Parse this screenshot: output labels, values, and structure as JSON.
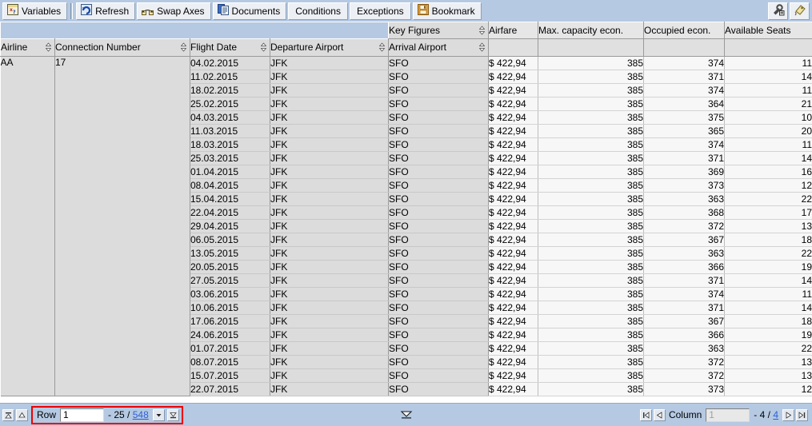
{
  "toolbar": {
    "buttons": [
      {
        "label": "Variables",
        "icon": "variables-icon"
      },
      {
        "label": "Refresh",
        "icon": "refresh-icon"
      },
      {
        "label": "Swap Axes",
        "icon": "swap-axes-icon"
      },
      {
        "label": "Documents",
        "icon": "documents-icon"
      },
      {
        "label": "Conditions",
        "icon": "none"
      },
      {
        "label": "Exceptions",
        "icon": "none"
      },
      {
        "label": "Bookmark",
        "icon": "bookmark-icon"
      }
    ],
    "right_buttons": [
      {
        "icon": "settings-wrench-icon"
      },
      {
        "icon": "info-tag-icon"
      }
    ]
  },
  "grid": {
    "key_figures_label": "Key Figures",
    "dimension_headers": [
      "Airline",
      "Connection Number",
      "Flight Date",
      "Departure Airport",
      "Arrival Airport"
    ],
    "key_figure_headers": [
      "Airfare",
      "Max. capacity econ.",
      "Occupied econ.",
      "Available Seats"
    ],
    "airline": "AA",
    "connection_number": "17",
    "rows": [
      {
        "flight_date": "04.02.2015",
        "departure": "JFK",
        "arrival": "SFO",
        "airfare": "$ 422,94",
        "max_capacity": "385",
        "occupied": "374",
        "available": "11"
      },
      {
        "flight_date": "11.02.2015",
        "departure": "JFK",
        "arrival": "SFO",
        "airfare": "$ 422,94",
        "max_capacity": "385",
        "occupied": "371",
        "available": "14"
      },
      {
        "flight_date": "18.02.2015",
        "departure": "JFK",
        "arrival": "SFO",
        "airfare": "$ 422,94",
        "max_capacity": "385",
        "occupied": "374",
        "available": "11"
      },
      {
        "flight_date": "25.02.2015",
        "departure": "JFK",
        "arrival": "SFO",
        "airfare": "$ 422,94",
        "max_capacity": "385",
        "occupied": "364",
        "available": "21"
      },
      {
        "flight_date": "04.03.2015",
        "departure": "JFK",
        "arrival": "SFO",
        "airfare": "$ 422,94",
        "max_capacity": "385",
        "occupied": "375",
        "available": "10"
      },
      {
        "flight_date": "11.03.2015",
        "departure": "JFK",
        "arrival": "SFO",
        "airfare": "$ 422,94",
        "max_capacity": "385",
        "occupied": "365",
        "available": "20"
      },
      {
        "flight_date": "18.03.2015",
        "departure": "JFK",
        "arrival": "SFO",
        "airfare": "$ 422,94",
        "max_capacity": "385",
        "occupied": "374",
        "available": "11"
      },
      {
        "flight_date": "25.03.2015",
        "departure": "JFK",
        "arrival": "SFO",
        "airfare": "$ 422,94",
        "max_capacity": "385",
        "occupied": "371",
        "available": "14"
      },
      {
        "flight_date": "01.04.2015",
        "departure": "JFK",
        "arrival": "SFO",
        "airfare": "$ 422,94",
        "max_capacity": "385",
        "occupied": "369",
        "available": "16"
      },
      {
        "flight_date": "08.04.2015",
        "departure": "JFK",
        "arrival": "SFO",
        "airfare": "$ 422,94",
        "max_capacity": "385",
        "occupied": "373",
        "available": "12"
      },
      {
        "flight_date": "15.04.2015",
        "departure": "JFK",
        "arrival": "SFO",
        "airfare": "$ 422,94",
        "max_capacity": "385",
        "occupied": "363",
        "available": "22"
      },
      {
        "flight_date": "22.04.2015",
        "departure": "JFK",
        "arrival": "SFO",
        "airfare": "$ 422,94",
        "max_capacity": "385",
        "occupied": "368",
        "available": "17"
      },
      {
        "flight_date": "29.04.2015",
        "departure": "JFK",
        "arrival": "SFO",
        "airfare": "$ 422,94",
        "max_capacity": "385",
        "occupied": "372",
        "available": "13"
      },
      {
        "flight_date": "06.05.2015",
        "departure": "JFK",
        "arrival": "SFO",
        "airfare": "$ 422,94",
        "max_capacity": "385",
        "occupied": "367",
        "available": "18"
      },
      {
        "flight_date": "13.05.2015",
        "departure": "JFK",
        "arrival": "SFO",
        "airfare": "$ 422,94",
        "max_capacity": "385",
        "occupied": "363",
        "available": "22"
      },
      {
        "flight_date": "20.05.2015",
        "departure": "JFK",
        "arrival": "SFO",
        "airfare": "$ 422,94",
        "max_capacity": "385",
        "occupied": "366",
        "available": "19"
      },
      {
        "flight_date": "27.05.2015",
        "departure": "JFK",
        "arrival": "SFO",
        "airfare": "$ 422,94",
        "max_capacity": "385",
        "occupied": "371",
        "available": "14"
      },
      {
        "flight_date": "03.06.2015",
        "departure": "JFK",
        "arrival": "SFO",
        "airfare": "$ 422,94",
        "max_capacity": "385",
        "occupied": "374",
        "available": "11"
      },
      {
        "flight_date": "10.06.2015",
        "departure": "JFK",
        "arrival": "SFO",
        "airfare": "$ 422,94",
        "max_capacity": "385",
        "occupied": "371",
        "available": "14"
      },
      {
        "flight_date": "17.06.2015",
        "departure": "JFK",
        "arrival": "SFO",
        "airfare": "$ 422,94",
        "max_capacity": "385",
        "occupied": "367",
        "available": "18"
      },
      {
        "flight_date": "24.06.2015",
        "departure": "JFK",
        "arrival": "SFO",
        "airfare": "$ 422,94",
        "max_capacity": "385",
        "occupied": "366",
        "available": "19"
      },
      {
        "flight_date": "01.07.2015",
        "departure": "JFK",
        "arrival": "SFO",
        "airfare": "$ 422,94",
        "max_capacity": "385",
        "occupied": "363",
        "available": "22"
      },
      {
        "flight_date": "08.07.2015",
        "departure": "JFK",
        "arrival": "SFO",
        "airfare": "$ 422,94",
        "max_capacity": "385",
        "occupied": "372",
        "available": "13"
      },
      {
        "flight_date": "15.07.2015",
        "departure": "JFK",
        "arrival": "SFO",
        "airfare": "$ 422,94",
        "max_capacity": "385",
        "occupied": "372",
        "available": "13"
      },
      {
        "flight_date": "22.07.2015",
        "departure": "JFK",
        "arrival": "SFO",
        "airfare": "$ 422,94",
        "max_capacity": "385",
        "occupied": "373",
        "available": "12"
      }
    ]
  },
  "statusbar": {
    "row_label": "Row",
    "row_value": "1",
    "row_range": "- 25 /",
    "row_total": "548",
    "column_label": "Column",
    "column_value": "1",
    "column_range": "- 4 /",
    "column_total": "4",
    "highlight_color": "#ee0000",
    "link_color": "#2b5fd9"
  }
}
